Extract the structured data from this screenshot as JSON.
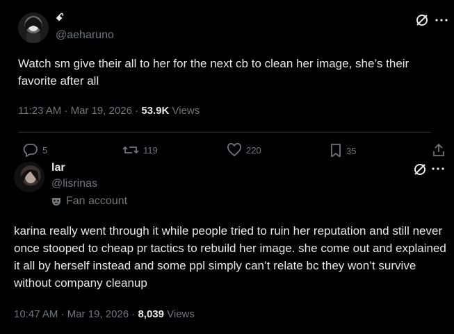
{
  "tweet1": {
    "name_glyph": "ꗃ",
    "handle": "@aeharuno",
    "text": "Watch sm give their all to her for the next cb to clean her image, she’s their favorite after all",
    "time": "11:23 AM · Mar 19, 2026 · ",
    "views_count": "53.9K",
    "views_label": " Views",
    "actions": {
      "replies": "5",
      "reposts": "119",
      "likes": "220",
      "bookmarks": "35"
    }
  },
  "tweet2": {
    "name": "lar",
    "handle": "@lisrinas",
    "badge": "Fan account",
    "text": "karina really went through it while people tried to ruin her reputation and still never once stooped to cheap pr tactics to rebuild her image. she come out and explained it all by herself instead and some ppl simply can’t relate bc they won’t survive without company cleanup",
    "time": "10:47 AM · Mar 19, 2026 · ",
    "views_count": "8,039",
    "views_label": " Views"
  },
  "colors": {
    "background": "#000000",
    "text": "#e7e9ea",
    "secondary": "#71767b",
    "divider": "#2f3336"
  },
  "icons": [
    "grok-icon",
    "more-icon",
    "reply-icon",
    "repost-icon",
    "like-icon",
    "bookmark-icon",
    "share-icon",
    "fan-mask-icon"
  ]
}
